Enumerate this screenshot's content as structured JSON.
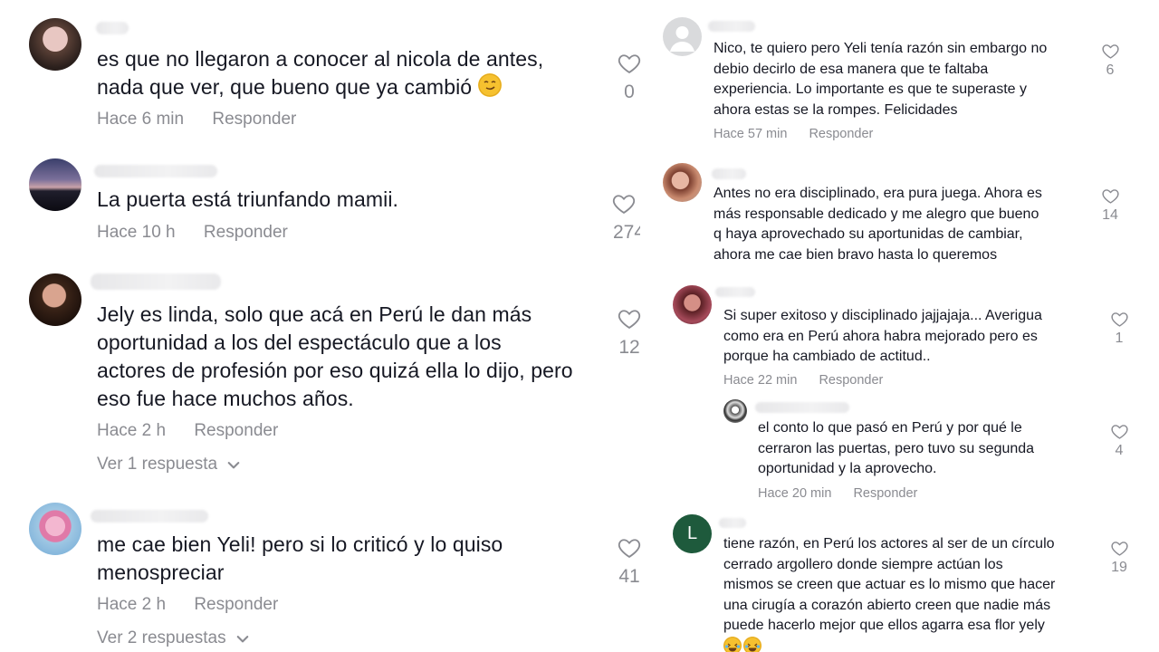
{
  "left": {
    "comments": [
      {
        "text": "es que no llegaron a conocer al nicola de antes,\nnada que ver, que bueno que ya cambió",
        "emoji": "smirk-emoji",
        "time": "Hace 6 min",
        "reply": "Responder",
        "likes": "0"
      },
      {
        "text": "La puerta está triunfando mamii.",
        "time": "Hace 10 h",
        "reply": "Responder",
        "likes": "274"
      },
      {
        "text": "Jely es linda, solo que acá en Perú le dan más\noportunidad a los del espectáculo que a los\nactores de profesión por eso quizá ella lo dijo, pero\neso fue hace muchos años.",
        "time": "Hace 2 h",
        "reply": "Responder",
        "likes": "12",
        "more": "Ver 1 respuesta"
      },
      {
        "text": "me cae bien Yeli! pero si lo criticó y lo quiso\nmenospreciar",
        "time": "Hace 2 h",
        "reply": "Responder",
        "likes": "41",
        "more": "Ver 2 respuestas"
      }
    ]
  },
  "right": {
    "comments": [
      {
        "text": "Nico, te quiero pero Yeli tenía razón sin embargo no\ndebio decirlo de esa manera que te faltaba\nexperiencia. Lo importante es que te superaste y\nahora estas se la rompes. Felicidades",
        "time": "Hace 57 min",
        "reply": "Responder",
        "likes": "6"
      },
      {
        "text": "Antes no era disciplinado, era pura juega. Ahora es\nmás responsable dedicado y me alegro que bueno\nq haya aprovechado su aportunidas de cambiar,\nahora me cae bien bravo hasta lo queremos",
        "likes": "14"
      },
      {
        "text": "Si super exitoso y disciplinado jajjajaja... Averigua\ncomo era en Perú ahora habra mejorado pero es\nporque ha cambiado de actitud..",
        "time": "Hace 22 min",
        "reply": "Responder",
        "likes": "1"
      },
      {
        "text": "el conto lo que pasó en Perú y por qué le\ncerraron las puertas, pero tuvo su segunda\noportunidad y la aprovecho.",
        "time": "Hace 20 min",
        "reply": "Responder",
        "likes": "4"
      },
      {
        "avatar_letter": "L",
        "text": "tiene razón, en Perú los actores al ser de un círculo\ncerrado argollero donde siempre actúan los\nmismos se creen que actuar es lo mismo que hacer\nuna cirugía a corazón abierto creen que nadie más\npuede hacerlo mejor que ellos agarra esa flor yely",
        "emoji": "laughing-emoji",
        "likes": "19"
      }
    ]
  },
  "colors": {
    "text": "#161823",
    "meta": "#8a8b91",
    "avatar_L": "#1e5a3c"
  }
}
